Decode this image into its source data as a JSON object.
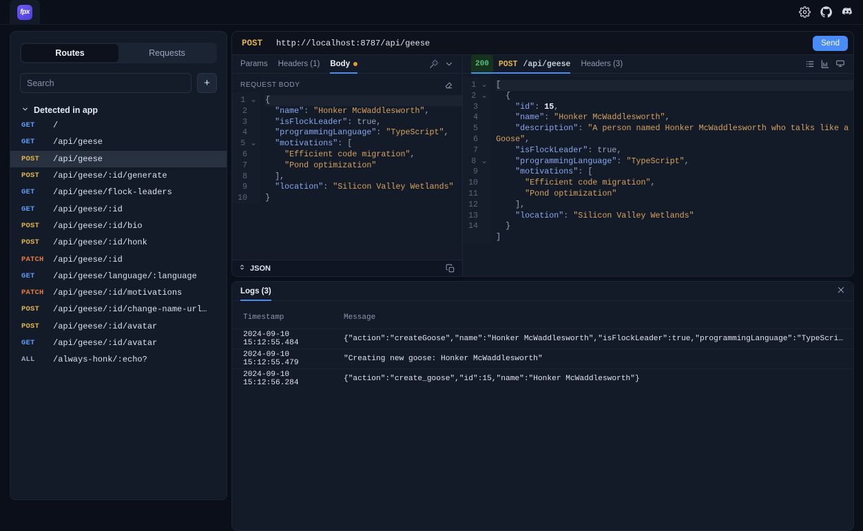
{
  "app": {
    "logo_text": "fpx",
    "top_icons": [
      "gear-icon",
      "github-icon",
      "discord-icon"
    ]
  },
  "sidebar": {
    "tabs": [
      {
        "label": "Routes",
        "active": true
      },
      {
        "label": "Requests",
        "active": false
      }
    ],
    "search": {
      "value": "",
      "placeholder": "Search"
    },
    "add_button_label": "+",
    "group_label": "Detected in app",
    "group_chevron": "chevron-down-icon",
    "routes": [
      {
        "method": "GET",
        "path": "/",
        "selected": false
      },
      {
        "method": "GET",
        "path": "/api/geese",
        "selected": false
      },
      {
        "method": "POST",
        "path": "/api/geese",
        "selected": true
      },
      {
        "method": "POST",
        "path": "/api/geese/:id/generate",
        "selected": false
      },
      {
        "method": "GET",
        "path": "/api/geese/flock-leaders",
        "selected": false
      },
      {
        "method": "GET",
        "path": "/api/geese/:id",
        "selected": false
      },
      {
        "method": "POST",
        "path": "/api/geese/:id/bio",
        "selected": false
      },
      {
        "method": "POST",
        "path": "/api/geese/:id/honk",
        "selected": false
      },
      {
        "method": "PATCH",
        "path": "/api/geese/:id",
        "selected": false
      },
      {
        "method": "GET",
        "path": "/api/geese/language/:language",
        "selected": false
      },
      {
        "method": "PATCH",
        "path": "/api/geese/:id/motivations",
        "selected": false
      },
      {
        "method": "POST",
        "path": "/api/geese/:id/change-name-url…",
        "selected": false
      },
      {
        "method": "POST",
        "path": "/api/geese/:id/avatar",
        "selected": false
      },
      {
        "method": "GET",
        "path": "/api/geese/:id/avatar",
        "selected": false
      },
      {
        "method": "ALL",
        "path": "/always-honk/:echo?",
        "selected": false
      }
    ]
  },
  "request": {
    "method": "POST",
    "url": "http://localhost:8787/api/geese",
    "send_label": "Send",
    "tabs": [
      {
        "label": "Params",
        "active": false,
        "dot": false
      },
      {
        "label": "Headers (1)",
        "active": false,
        "dot": false
      },
      {
        "label": "Body",
        "active": true,
        "dot": true
      }
    ],
    "tab_icons": [
      "magic-wand-icon",
      "chevron-down-icon"
    ],
    "body_label": "REQUEST BODY",
    "body_panel_icon": "eraser-icon",
    "body_lines": [
      {
        "n": "1",
        "fold": true,
        "html": "<span class=\"pn\">{</span>"
      },
      {
        "n": "2",
        "fold": false,
        "html": "  <span class=\"k\">\"name\"</span><span class=\"pn\">: </span><span class=\"s\">\"Honker McWaddlesworth\"</span><span class=\"pn\">,</span>"
      },
      {
        "n": "3",
        "fold": false,
        "html": "  <span class=\"k\">\"isFlockLeader\"</span><span class=\"pn\">: </span><span class=\"b\">true</span><span class=\"pn\">,</span>"
      },
      {
        "n": "4",
        "fold": false,
        "html": "  <span class=\"k\">\"programmingLanguage\"</span><span class=\"pn\">: </span><span class=\"s\">\"TypeScript\"</span><span class=\"pn\">,</span>"
      },
      {
        "n": "5",
        "fold": true,
        "html": "  <span class=\"k\">\"motivations\"</span><span class=\"pn\">: [</span>"
      },
      {
        "n": "6",
        "fold": false,
        "html": "    <span class=\"s\">\"Efficient code migration\"</span><span class=\"pn\">,</span>"
      },
      {
        "n": "7",
        "fold": false,
        "html": "    <span class=\"s\">\"Pond optimization\"</span>"
      },
      {
        "n": "8",
        "fold": false,
        "html": "  <span class=\"pn\">],</span>"
      },
      {
        "n": "9",
        "fold": false,
        "html": "  <span class=\"k\">\"location\"</span><span class=\"pn\">: </span><span class=\"s\">\"Silicon Valley Wetlands\"</span>"
      },
      {
        "n": "10",
        "fold": false,
        "html": "<span class=\"pn\">}</span>"
      }
    ],
    "footer": {
      "format": "JSON",
      "sort_icon": "sort-icon",
      "copy_icon": "copy-icon"
    }
  },
  "response": {
    "status": "200",
    "method": "POST",
    "path": "/api/geese",
    "headers_tab": "Headers (3)",
    "view_icons": [
      "list-view-icon",
      "chart-view-icon",
      "raw-view-icon"
    ],
    "body_lines": [
      {
        "n": "1",
        "fold": true,
        "html": "<span class=\"pn\">[</span>"
      },
      {
        "n": "2",
        "fold": true,
        "html": "  <span class=\"pn\">{</span>"
      },
      {
        "n": "3",
        "fold": false,
        "html": "    <span class=\"k\">\"id\"</span><span class=\"pn\">: </span><span class=\"n\">15</span><span class=\"pn\">,</span>"
      },
      {
        "n": "4",
        "fold": false,
        "html": "    <span class=\"k\">\"name\"</span><span class=\"pn\">: </span><span class=\"s\">\"Honker McWaddlesworth\"</span><span class=\"pn\">,</span>"
      },
      {
        "n": "5",
        "fold": false,
        "html": "    <span class=\"k\">\"description\"</span><span class=\"pn\">: </span><span class=\"s\">\"A person named Honker McWaddlesworth who talks like a Goose\"</span><span class=\"pn\">,</span>"
      },
      {
        "n": "6",
        "fold": false,
        "html": "    <span class=\"k\">\"isFlockLeader\"</span><span class=\"pn\">: </span><span class=\"b\">true</span><span class=\"pn\">,</span>"
      },
      {
        "n": "7",
        "fold": false,
        "html": "    <span class=\"k\">\"programmingLanguage\"</span><span class=\"pn\">: </span><span class=\"s\">\"TypeScript\"</span><span class=\"pn\">,</span>"
      },
      {
        "n": "8",
        "fold": true,
        "html": "    <span class=\"k\">\"motivations\"</span><span class=\"pn\">: [</span>"
      },
      {
        "n": "9",
        "fold": false,
        "html": "      <span class=\"s\">\"Efficient code migration\"</span><span class=\"pn\">,</span>"
      },
      {
        "n": "10",
        "fold": false,
        "html": "      <span class=\"s\">\"Pond optimization\"</span>"
      },
      {
        "n": "11",
        "fold": false,
        "html": "    <span class=\"pn\">],</span>"
      },
      {
        "n": "12",
        "fold": false,
        "html": "    <span class=\"k\">\"location\"</span><span class=\"pn\">: </span><span class=\"s\">\"Silicon Valley Wetlands\"</span>"
      },
      {
        "n": "13",
        "fold": false,
        "html": "  <span class=\"pn\">}</span>"
      },
      {
        "n": "14",
        "fold": false,
        "html": "<span class=\"pn\">]</span>"
      }
    ]
  },
  "logs": {
    "tab_label": "Logs (3)",
    "close_icon": "close-icon",
    "columns": {
      "timestamp": "Timestamp",
      "message": "Message"
    },
    "rows": [
      {
        "timestamp": "2024-09-10 15:12:55.484",
        "message": "{\"action\":\"createGoose\",\"name\":\"Honker McWaddlesworth\",\"isFlockLeader\":true,\"programmingLanguage\":\"TypeScript\"}"
      },
      {
        "timestamp": "2024-09-10 15:12:55.479",
        "message": "\"Creating new goose: Honker McWaddlesworth\""
      },
      {
        "timestamp": "2024-09-10 15:12:56.284",
        "message": "{\"action\":\"create_goose\",\"id\":15,\"name\":\"Honker McWaddlesworth\"}"
      }
    ]
  },
  "colors": {
    "accent": "#4a8cf7",
    "background": "#0b0f19",
    "panel": "#131a28",
    "get": "#5b9bf8",
    "post": "#e0b44a",
    "patch": "#e3793f",
    "status_ok": "#54c07b"
  }
}
